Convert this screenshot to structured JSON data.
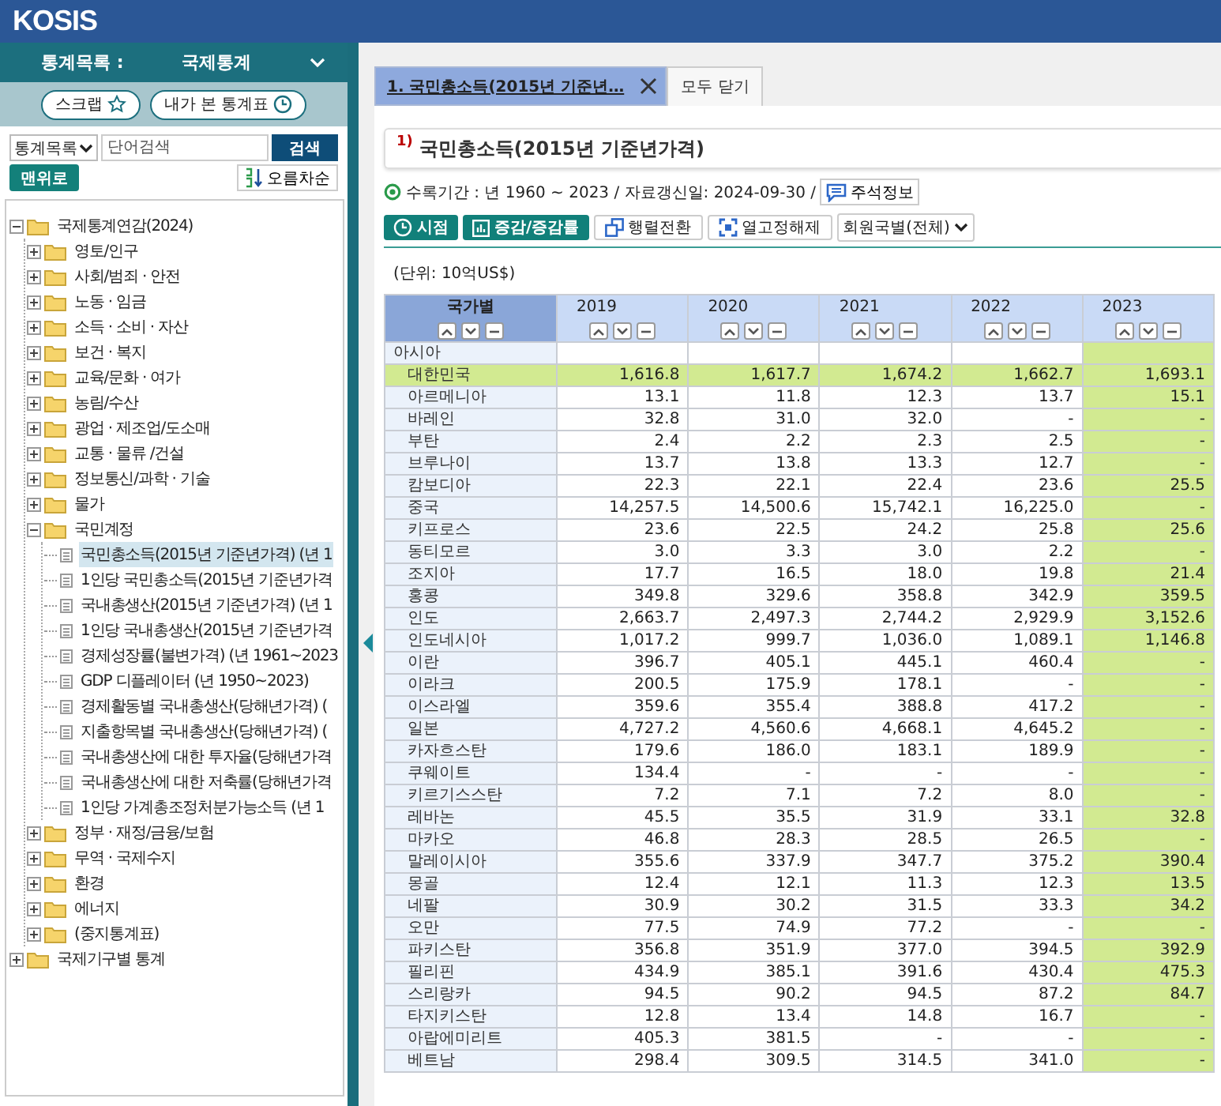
{
  "app": {
    "logo": "KOSIS"
  },
  "sidebar": {
    "category_label": "통계목록 :",
    "category_value": "국제통계",
    "quick_buttons": [
      "스크랩",
      "내가 본 통계표"
    ],
    "search": {
      "scope": "통계목록",
      "placeholder": "단어검색",
      "button": "검색"
    },
    "top_button": "맨위로",
    "sort_button": "오름차순",
    "tree": [
      {
        "label": "국제통계연감(2024)",
        "kind": "folder",
        "expanded": true,
        "selected": false,
        "children": [
          {
            "label": "영토/인구",
            "kind": "folder",
            "expanded": false,
            "selected": false
          },
          {
            "label": "사회/범죄 · 안전",
            "kind": "folder",
            "expanded": false,
            "selected": false
          },
          {
            "label": "노동 · 임금",
            "kind": "folder",
            "expanded": false,
            "selected": false
          },
          {
            "label": "소득 · 소비 · 자산",
            "kind": "folder",
            "expanded": false,
            "selected": false
          },
          {
            "label": "보건 · 복지",
            "kind": "folder",
            "expanded": false,
            "selected": false
          },
          {
            "label": "교육/문화 · 여가",
            "kind": "folder",
            "expanded": false,
            "selected": false
          },
          {
            "label": "농림/수산",
            "kind": "folder",
            "expanded": false,
            "selected": false
          },
          {
            "label": "광업 · 제조업/도소매",
            "kind": "folder",
            "expanded": false,
            "selected": false
          },
          {
            "label": "교통 · 물류 /건설",
            "kind": "folder",
            "expanded": false,
            "selected": false
          },
          {
            "label": "정보통신/과학 · 기술",
            "kind": "folder",
            "expanded": false,
            "selected": false
          },
          {
            "label": "물가",
            "kind": "folder",
            "expanded": false,
            "selected": false
          },
          {
            "label": "국민계정",
            "kind": "folder",
            "expanded": true,
            "selected": false,
            "children": [
              {
                "label": "국민총소득(2015년 기준년가격) (년 1",
                "kind": "document",
                "selected": true
              },
              {
                "label": "1인당 국민총소득(2015년 기준년가격",
                "kind": "document",
                "selected": false
              },
              {
                "label": "국내총생산(2015년 기준년가격) (년 1",
                "kind": "document",
                "selected": false
              },
              {
                "label": "1인당 국내총생산(2015년 기준년가격",
                "kind": "document",
                "selected": false
              },
              {
                "label": "경제성장률(불변가격) (년 1961~2023",
                "kind": "document",
                "selected": false
              },
              {
                "label": "GDP 디플레이터 (년 1950~2023)",
                "kind": "document",
                "selected": false
              },
              {
                "label": "경제활동별 국내총생산(당해년가격) (",
                "kind": "document",
                "selected": false
              },
              {
                "label": "지출항목별 국내총생산(당해년가격) (",
                "kind": "document",
                "selected": false
              },
              {
                "label": "국내총생산에 대한 투자율(당해년가격",
                "kind": "document",
                "selected": false
              },
              {
                "label": "국내총생산에 대한 저축률(당해년가격",
                "kind": "document",
                "selected": false
              },
              {
                "label": "1인당 가계총조정처분가능소득 (년 1",
                "kind": "document",
                "selected": false
              }
            ]
          },
          {
            "label": "정부 · 재정/금융/보험",
            "kind": "folder",
            "expanded": false,
            "selected": false
          },
          {
            "label": "무역 · 국제수지",
            "kind": "folder",
            "expanded": false,
            "selected": false
          },
          {
            "label": "환경",
            "kind": "folder",
            "expanded": false,
            "selected": false
          },
          {
            "label": "에너지",
            "kind": "folder",
            "expanded": false,
            "selected": false
          },
          {
            "label": "(중지통계표)",
            "kind": "folder",
            "expanded": false,
            "selected": false
          }
        ]
      },
      {
        "label": "국제기구별 통계",
        "kind": "folder",
        "expanded": false,
        "selected": false
      }
    ]
  },
  "tabs": [
    {
      "label": "1. 국민총소득(2015년 기준년…",
      "selected": true
    }
  ],
  "close_all": "모두 닫기",
  "title": {
    "note": "1)",
    "text": "국민총소득(2015년 기준년가격)"
  },
  "info": "수록기간 : 년 1960 ~ 2023 / 자료갱신일: 2024-09-30 /",
  "note_button": "주석정보",
  "toolbar": [
    {
      "label": "시점",
      "kind": "primary"
    },
    {
      "label": "증감/증감률",
      "kind": "primary"
    },
    {
      "label": "행렬전환",
      "kind": "secondary"
    },
    {
      "label": "열고정해제",
      "kind": "secondary"
    }
  ],
  "filter": "회원국별(전체)",
  "unit": "(단위: 10억US$)",
  "table": {
    "columns": [
      {
        "label": "국가별",
        "highlighted": false
      },
      {
        "label": "2019",
        "highlighted": false
      },
      {
        "label": "2020",
        "highlighted": false
      },
      {
        "label": "2021",
        "highlighted": false
      },
      {
        "label": "2022",
        "highlighted": false
      },
      {
        "label": "2023",
        "highlighted": true
      }
    ],
    "rows": [
      {
        "label": "아시아",
        "kind": "group",
        "highlighted": false
      },
      {
        "label": "대한민국",
        "kind": "item",
        "highlighted": true,
        "values": [
          "1,616.8",
          "1,617.7",
          "1,674.2",
          "1,662.7",
          "1,693.1"
        ]
      },
      {
        "label": "아르메니아",
        "kind": "item",
        "highlighted": false,
        "values": [
          "13.1",
          "11.8",
          "12.3",
          "13.7",
          "15.1"
        ]
      },
      {
        "label": "바레인",
        "kind": "item",
        "highlighted": false,
        "values": [
          "32.8",
          "31.0",
          "32.0",
          "-",
          "-"
        ]
      },
      {
        "label": "부탄",
        "kind": "item",
        "highlighted": false,
        "values": [
          "2.4",
          "2.2",
          "2.3",
          "2.5",
          "-"
        ]
      },
      {
        "label": "브루나이",
        "kind": "item",
        "highlighted": false,
        "values": [
          "13.7",
          "13.8",
          "13.3",
          "12.7",
          "-"
        ]
      },
      {
        "label": "캄보디아",
        "kind": "item",
        "highlighted": false,
        "values": [
          "22.3",
          "22.1",
          "22.4",
          "23.6",
          "25.5"
        ]
      },
      {
        "label": "중국",
        "kind": "item",
        "highlighted": false,
        "values": [
          "14,257.5",
          "14,500.6",
          "15,742.1",
          "16,225.0",
          "-"
        ]
      },
      {
        "label": "키프로스",
        "kind": "item",
        "highlighted": false,
        "values": [
          "23.6",
          "22.5",
          "24.2",
          "25.8",
          "25.6"
        ]
      },
      {
        "label": "동티모르",
        "kind": "item",
        "highlighted": false,
        "values": [
          "3.0",
          "3.3",
          "3.0",
          "2.2",
          "-"
        ]
      },
      {
        "label": "조지아",
        "kind": "item",
        "highlighted": false,
        "values": [
          "17.7",
          "16.5",
          "18.0",
          "19.8",
          "21.4"
        ]
      },
      {
        "label": "홍콩",
        "kind": "item",
        "highlighted": false,
        "values": [
          "349.8",
          "329.6",
          "358.8",
          "342.9",
          "359.5"
        ]
      },
      {
        "label": "인도",
        "kind": "item",
        "highlighted": false,
        "values": [
          "2,663.7",
          "2,497.3",
          "2,744.2",
          "2,929.9",
          "3,152.6"
        ]
      },
      {
        "label": "인도네시아",
        "kind": "item",
        "highlighted": false,
        "values": [
          "1,017.2",
          "999.7",
          "1,036.0",
          "1,089.1",
          "1,146.8"
        ]
      },
      {
        "label": "이란",
        "kind": "item",
        "highlighted": false,
        "values": [
          "396.7",
          "405.1",
          "445.1",
          "460.4",
          "-"
        ]
      },
      {
        "label": "이라크",
        "kind": "item",
        "highlighted": false,
        "values": [
          "200.5",
          "175.9",
          "178.1",
          "-",
          "-"
        ]
      },
      {
        "label": "이스라엘",
        "kind": "item",
        "highlighted": false,
        "values": [
          "359.6",
          "355.4",
          "388.8",
          "417.2",
          "-"
        ]
      },
      {
        "label": "일본",
        "kind": "item",
        "highlighted": false,
        "values": [
          "4,727.2",
          "4,560.6",
          "4,668.1",
          "4,645.2",
          "-"
        ]
      },
      {
        "label": "카자흐스탄",
        "kind": "item",
        "highlighted": false,
        "values": [
          "179.6",
          "186.0",
          "183.1",
          "189.9",
          "-"
        ]
      },
      {
        "label": "쿠웨이트",
        "kind": "item",
        "highlighted": false,
        "values": [
          "134.4",
          "-",
          "-",
          "-",
          "-"
        ]
      },
      {
        "label": "키르기스스탄",
        "kind": "item",
        "highlighted": false,
        "values": [
          "7.2",
          "7.1",
          "7.2",
          "8.0",
          "-"
        ]
      },
      {
        "label": "레바논",
        "kind": "item",
        "highlighted": false,
        "values": [
          "45.5",
          "35.5",
          "31.9",
          "33.1",
          "32.8"
        ]
      },
      {
        "label": "마카오",
        "kind": "item",
        "highlighted": false,
        "values": [
          "46.8",
          "28.3",
          "28.5",
          "26.5",
          "-"
        ]
      },
      {
        "label": "말레이시아",
        "kind": "item",
        "highlighted": false,
        "values": [
          "355.6",
          "337.9",
          "347.7",
          "375.2",
          "390.4"
        ]
      },
      {
        "label": "몽골",
        "kind": "item",
        "highlighted": false,
        "values": [
          "12.4",
          "12.1",
          "11.3",
          "12.3",
          "13.5"
        ]
      },
      {
        "label": "네팔",
        "kind": "item",
        "highlighted": false,
        "values": [
          "30.9",
          "30.2",
          "31.5",
          "33.3",
          "34.2"
        ]
      },
      {
        "label": "오만",
        "kind": "item",
        "highlighted": false,
        "values": [
          "77.5",
          "74.9",
          "77.2",
          "-",
          "-"
        ]
      },
      {
        "label": "파키스탄",
        "kind": "item",
        "highlighted": false,
        "values": [
          "356.8",
          "351.9",
          "377.0",
          "394.5",
          "392.9"
        ]
      },
      {
        "label": "필리핀",
        "kind": "item",
        "highlighted": false,
        "values": [
          "434.9",
          "385.1",
          "391.6",
          "430.4",
          "475.3"
        ]
      },
      {
        "label": "스리랑카",
        "kind": "item",
        "highlighted": false,
        "values": [
          "94.5",
          "90.2",
          "94.5",
          "87.2",
          "84.7"
        ]
      },
      {
        "label": "타지키스탄",
        "kind": "item",
        "highlighted": false,
        "values": [
          "12.8",
          "13.4",
          "14.8",
          "16.7",
          "-"
        ]
      },
      {
        "label": "아랍에미리트",
        "kind": "item",
        "highlighted": false,
        "values": [
          "405.3",
          "381.5",
          "-",
          "-",
          "-"
        ]
      },
      {
        "label": "베트남",
        "kind": "item",
        "highlighted": false,
        "values": [
          "298.4",
          "309.5",
          "314.5",
          "341.0",
          "-"
        ]
      }
    ]
  }
}
